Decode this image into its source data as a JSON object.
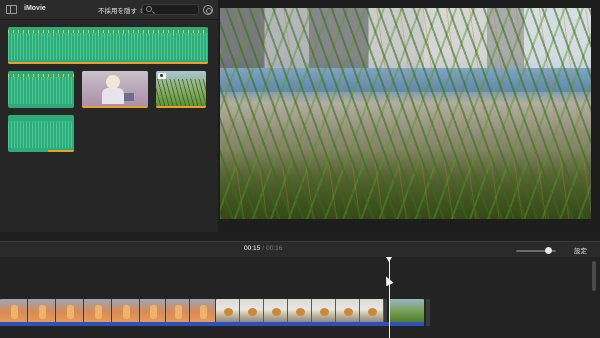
{
  "browser": {
    "app_name": "iMovie",
    "filter_label": "不採用を隠す",
    "search_placeholder": "",
    "clips": [
      {
        "kind": "audio"
      },
      {
        "kind": "audio"
      },
      {
        "kind": "video",
        "subject": "woman-with-items"
      },
      {
        "kind": "video",
        "subject": "grass",
        "icon": "camera-icon"
      },
      {
        "kind": "audio"
      }
    ]
  },
  "viewer": {
    "subject": "grass-by-river"
  },
  "timeline_header": {
    "current_time": "00:15",
    "separator": "/",
    "total_time": "00:16",
    "settings_label": "設定",
    "zoom_level": 0.8
  },
  "colors": {
    "accent_audio": "#2faa7a",
    "used_marker": "#e8a02a",
    "audio_track": "#3050b9",
    "playhead": "#f0f0f0"
  }
}
